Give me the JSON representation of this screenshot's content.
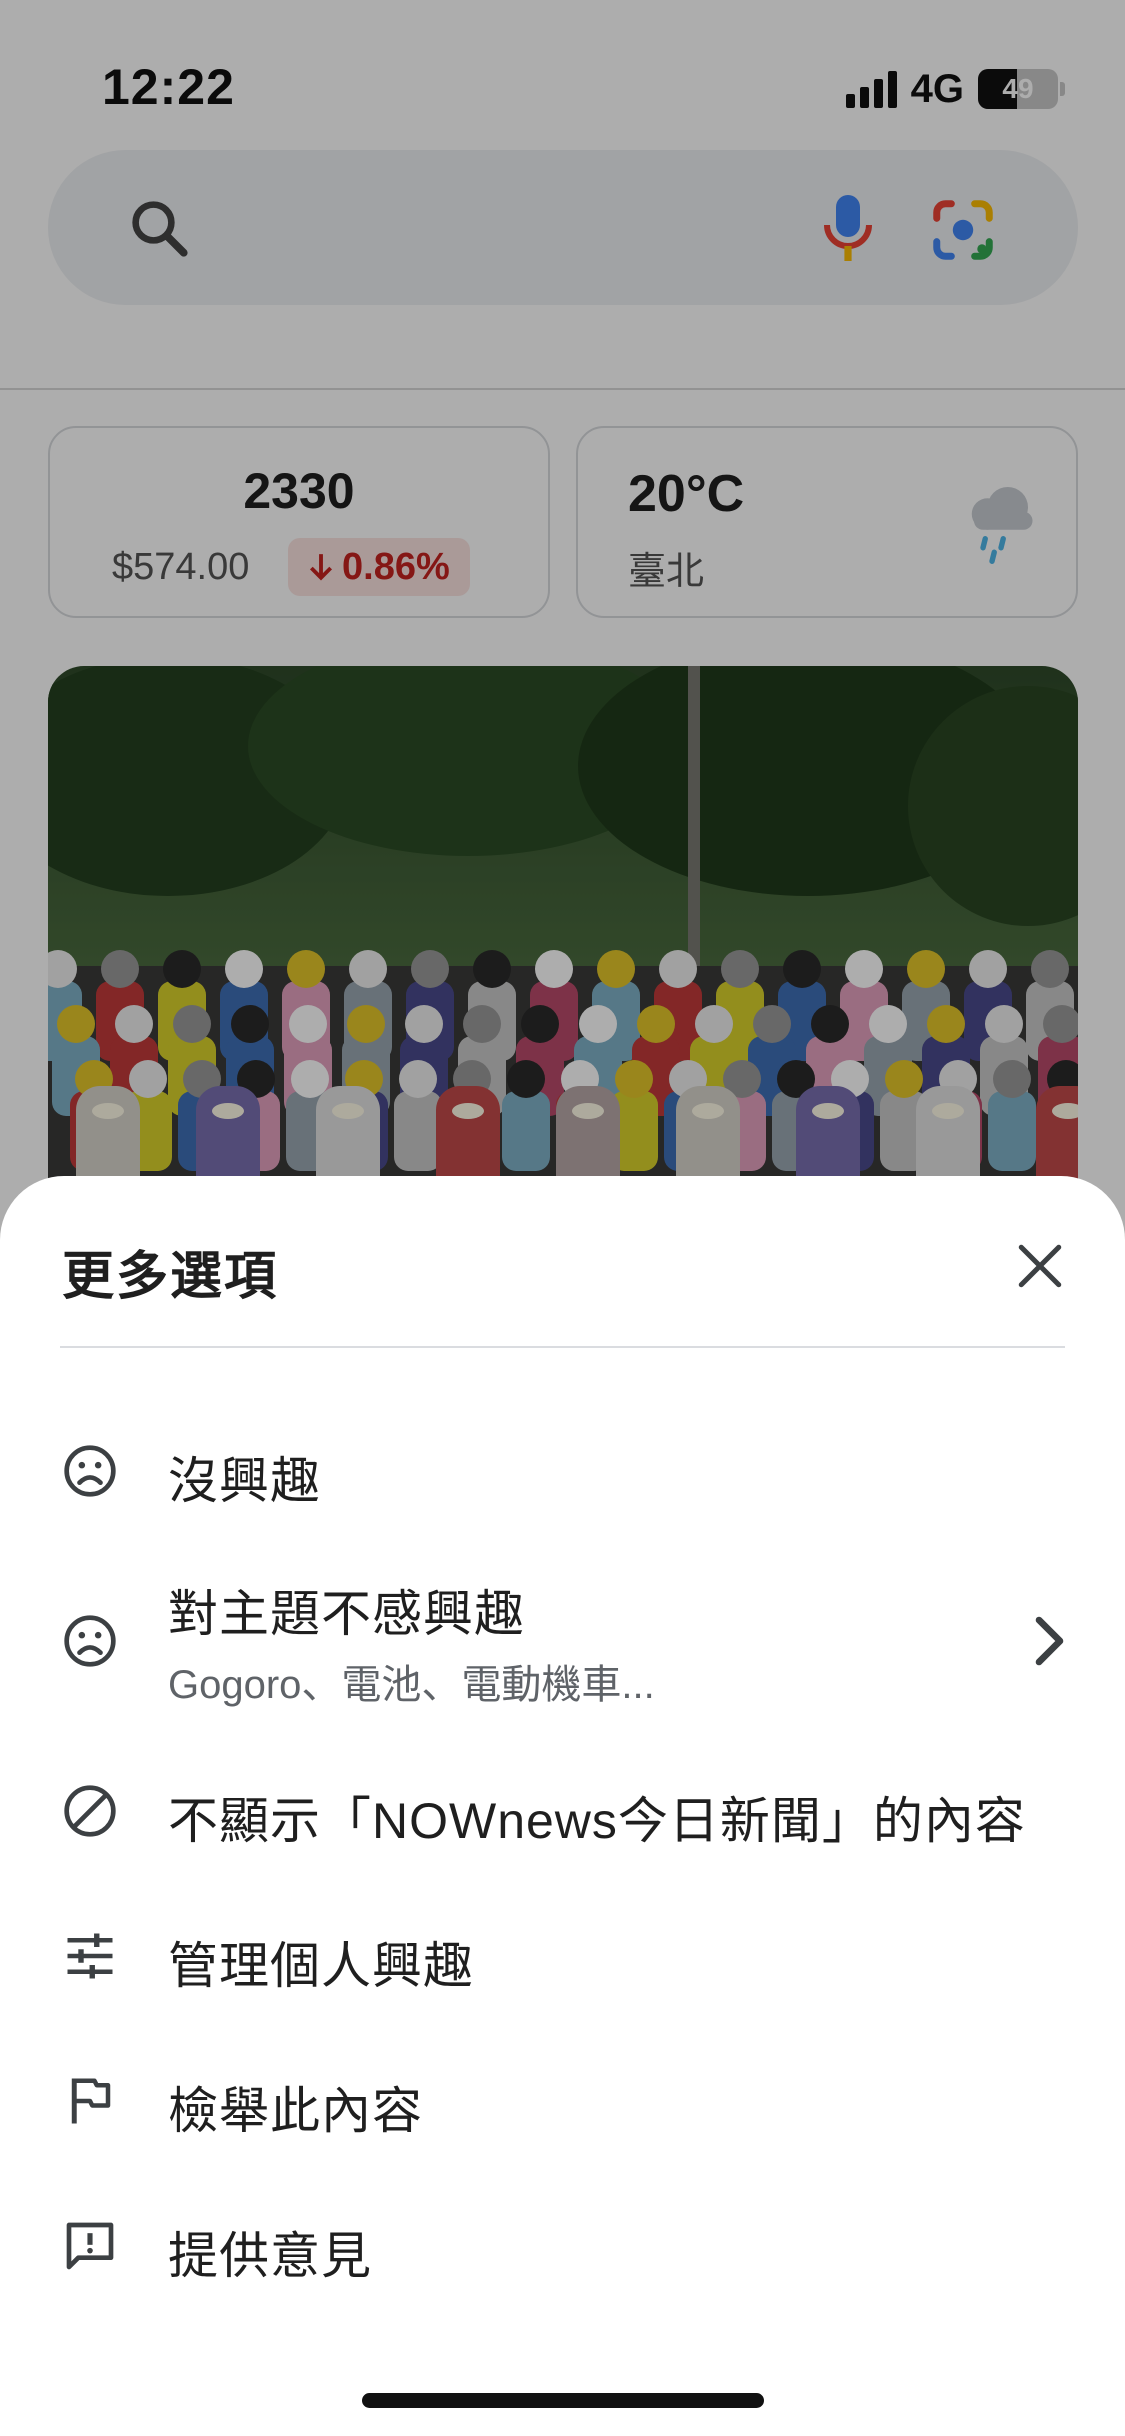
{
  "status_bar": {
    "time": "12:22",
    "network": "4G",
    "battery_percent": "49",
    "battery_level": 0.49
  },
  "search": {
    "placeholder": ""
  },
  "stock_card": {
    "ticker": "2330",
    "price": "$574.00",
    "change": "0.86%",
    "direction": "down",
    "change_color": "#c5221f"
  },
  "weather_card": {
    "temperature": "20°C",
    "city": "臺北",
    "icon": "rain-cloud-icon"
  },
  "sheet": {
    "title": "更多選項",
    "items": [
      {
        "label": "沒興趣",
        "icon": "sad-face-icon"
      },
      {
        "label": "對主題不感興趣",
        "sublabel": "Gogoro、電池、電動機車...",
        "icon": "sad-face-icon",
        "has_chevron": true
      },
      {
        "label": "不顯示「NOWnews今日新聞」的內容",
        "icon": "block-icon"
      },
      {
        "label": "管理個人興趣",
        "icon": "tune-icon"
      },
      {
        "label": "檢舉此內容",
        "icon": "flag-icon"
      },
      {
        "label": "提供意見",
        "icon": "feedback-icon"
      }
    ]
  },
  "colors": {
    "scrim": "rgba(0,0,0,0.32)",
    "text_primary": "#1f1f1f",
    "text_secondary": "#5f6368"
  }
}
